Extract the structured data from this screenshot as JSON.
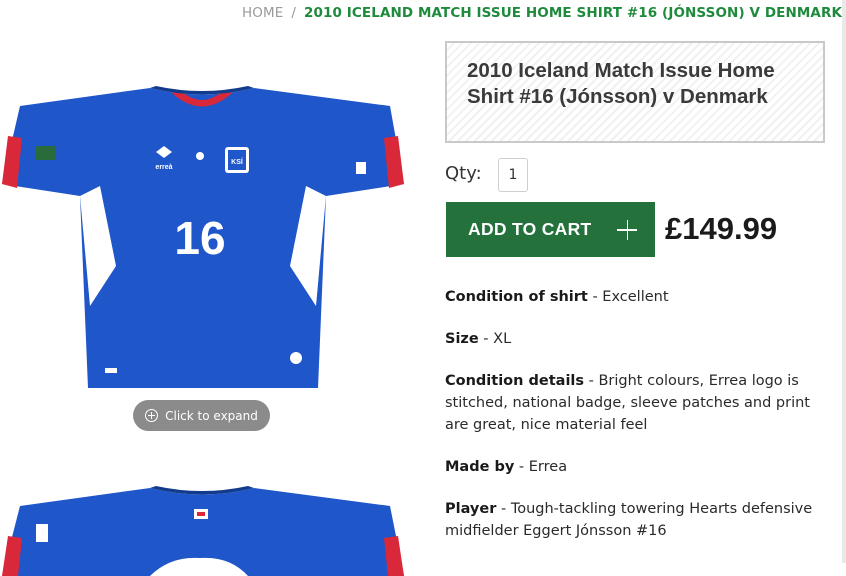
{
  "breadcrumb": {
    "home": "HOME",
    "separator": "/",
    "current": "2010 ICELAND MATCH ISSUE HOME SHIRT #16 (JÓNSSON) V DENMARK"
  },
  "gallery": {
    "expand_label": "Click to expand",
    "shirt_number": "16",
    "badge_text": "KSÍ",
    "brand_text": "erreà"
  },
  "product": {
    "title": "2010 Iceland Match Issue Home Shirt #16 (Jónsson) v Denmark",
    "qty_label": "Qty:",
    "qty_value": "1",
    "add_to_cart": "ADD TO CART",
    "price": "£149.99"
  },
  "details": [
    {
      "label": "Condition of shirt",
      "sep": " - ",
      "value": "Excellent"
    },
    {
      "label": "Size",
      "sep": " - ",
      "value": "XL"
    },
    {
      "label": "Condition details",
      "sep": " - ",
      "value": "Bright colours, Errea logo is stitched, national badge, sleeve patches and print are great, nice material feel"
    },
    {
      "label": "Made by",
      "sep": " - ",
      "value": "Errea"
    },
    {
      "label": "Player",
      "sep": " - ",
      "value": "Tough-tackling towering Hearts defensive midfielder Eggert Jónsson #16"
    }
  ],
  "colors": {
    "brand_green": "#25713b",
    "breadcrumb_green": "#1e8a3c",
    "shirt_blue": "#1f56c9",
    "shirt_red": "#d8283a"
  }
}
